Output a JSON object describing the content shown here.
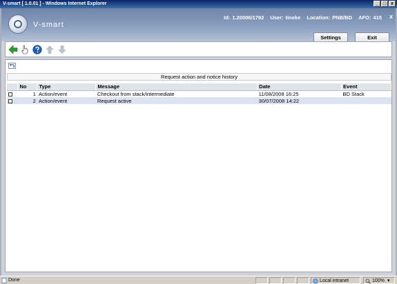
{
  "window": {
    "title": "V-smart [ 1.0.01 ] - Windows Internet Explorer",
    "minimize_glyph": "_",
    "maximize_glyph": "□",
    "close_glyph": "x"
  },
  "header": {
    "logo_text": "V-smart",
    "id_text": "Id: 1.20006/1792",
    "user_text": "User: tineke",
    "location_text": "Location: PNB/BD",
    "afo_text": "AFO: 415",
    "close_glyph": "x",
    "settings_label": "Settings",
    "exit_label": "Exit"
  },
  "toolbar": {
    "icons": [
      "back-arrow-icon",
      "hand-pointer-icon",
      "help-icon",
      "arrow-up-icon",
      "arrow-down-icon"
    ],
    "colors": {
      "back": "#2f9a2f",
      "help": "#1b5fb4",
      "disabled": "#b9c1cc"
    }
  },
  "main": {
    "section_title": "Request action and notice history",
    "columns": [
      "No",
      "Type",
      "Message",
      "Date",
      "Event"
    ],
    "rows": [
      {
        "no": "1",
        "type": "Action/event",
        "message": "Checkout from stack/intermediate",
        "date": "11/08/2008 16:25",
        "event": "BD Stack"
      },
      {
        "no": "2",
        "type": "Action/event",
        "message": "Request active",
        "date": "30/07/2008 14:22",
        "event": ""
      }
    ]
  },
  "statusbar": {
    "status": "Done",
    "zone": "Local intranet",
    "zoom": "100%"
  }
}
